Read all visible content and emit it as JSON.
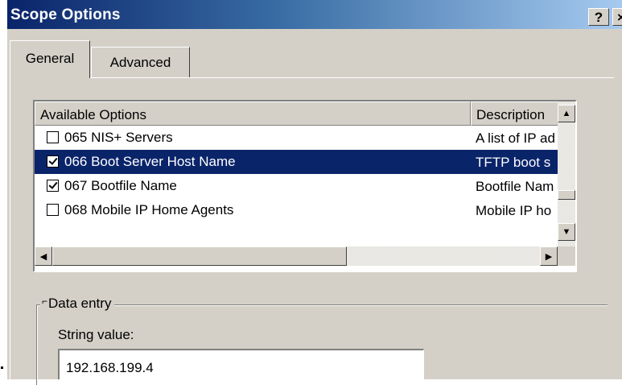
{
  "window": {
    "title": "Scope Options",
    "help_label": "?",
    "close_label": "×"
  },
  "tabs": [
    {
      "label": "General",
      "active": true
    },
    {
      "label": "Advanced",
      "active": false
    }
  ],
  "options_list": {
    "columns": [
      "Available Options",
      "Description"
    ],
    "rows": [
      {
        "label": "065 NIS+ Servers",
        "description": "A list of IP ad",
        "checked": false,
        "selected": false
      },
      {
        "label": "066 Boot Server Host Name",
        "description": "TFTP boot s",
        "checked": true,
        "selected": true
      },
      {
        "label": "067 Bootfile Name",
        "description": "Bootfile Nam",
        "checked": true,
        "selected": false
      },
      {
        "label": "068 Mobile IP Home Agents",
        "description": "Mobile IP ho",
        "checked": false,
        "selected": false
      }
    ]
  },
  "data_entry": {
    "group_label": "Data entry",
    "string_value_label": "String value:",
    "string_value": "192.168.199.4"
  },
  "colors": {
    "selection": "#0a246a",
    "dialog_face": "#d4d0c8"
  }
}
